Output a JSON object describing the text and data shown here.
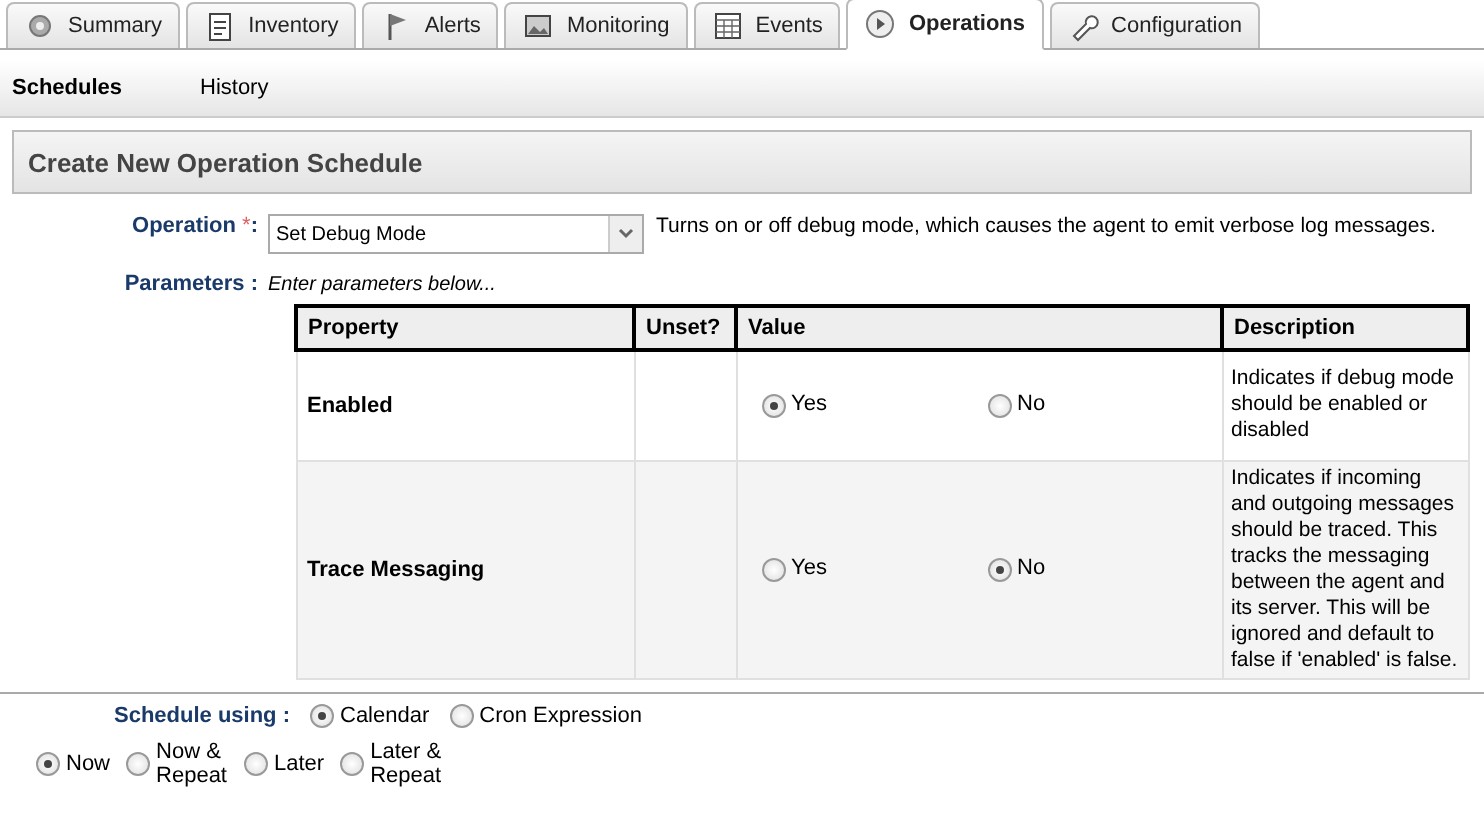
{
  "tabs": [
    {
      "label": "Summary",
      "selected": false
    },
    {
      "label": "Inventory",
      "selected": false
    },
    {
      "label": "Alerts",
      "selected": false
    },
    {
      "label": "Monitoring",
      "selected": false
    },
    {
      "label": "Events",
      "selected": false
    },
    {
      "label": "Operations",
      "selected": true
    },
    {
      "label": "Configuration",
      "selected": false
    }
  ],
  "subtabs": [
    {
      "label": "Schedules",
      "selected": true
    },
    {
      "label": "History",
      "selected": false
    }
  ],
  "panel_title": "Create New Operation Schedule",
  "operation": {
    "label": "Operation",
    "required_mark": "*",
    "colon": ":",
    "value": "Set Debug Mode",
    "description": "Turns on or off debug mode, which causes the agent to emit verbose log messages."
  },
  "parameters": {
    "label": "Parameters :",
    "hint": "Enter parameters below..."
  },
  "table": {
    "columns": [
      "Property",
      "Unset?",
      "Value",
      "Description"
    ],
    "rows": [
      {
        "property": "Enabled",
        "options": [
          {
            "label": "Yes",
            "selected": true
          },
          {
            "label": "No",
            "selected": false
          }
        ],
        "description": "Indicates if debug mode should be enabled or disabled"
      },
      {
        "property": "Trace Messaging",
        "options": [
          {
            "label": "Yes",
            "selected": false
          },
          {
            "label": "No",
            "selected": true
          }
        ],
        "description": "Indicates if incoming and outgoing messages should be traced. This tracks the messaging between the agent and its server. This will be ignored and default to false if 'enabled' is false."
      }
    ]
  },
  "schedule_using": {
    "label": "Schedule using :",
    "options": [
      {
        "label": "Calendar",
        "selected": true
      },
      {
        "label": "Cron Expression",
        "selected": false
      }
    ]
  },
  "timing": [
    {
      "label": "Now",
      "selected": true
    },
    {
      "label": "Now & Repeat",
      "selected": false
    },
    {
      "label": "Later",
      "selected": false
    },
    {
      "label": "Later & Repeat",
      "selected": false
    }
  ]
}
